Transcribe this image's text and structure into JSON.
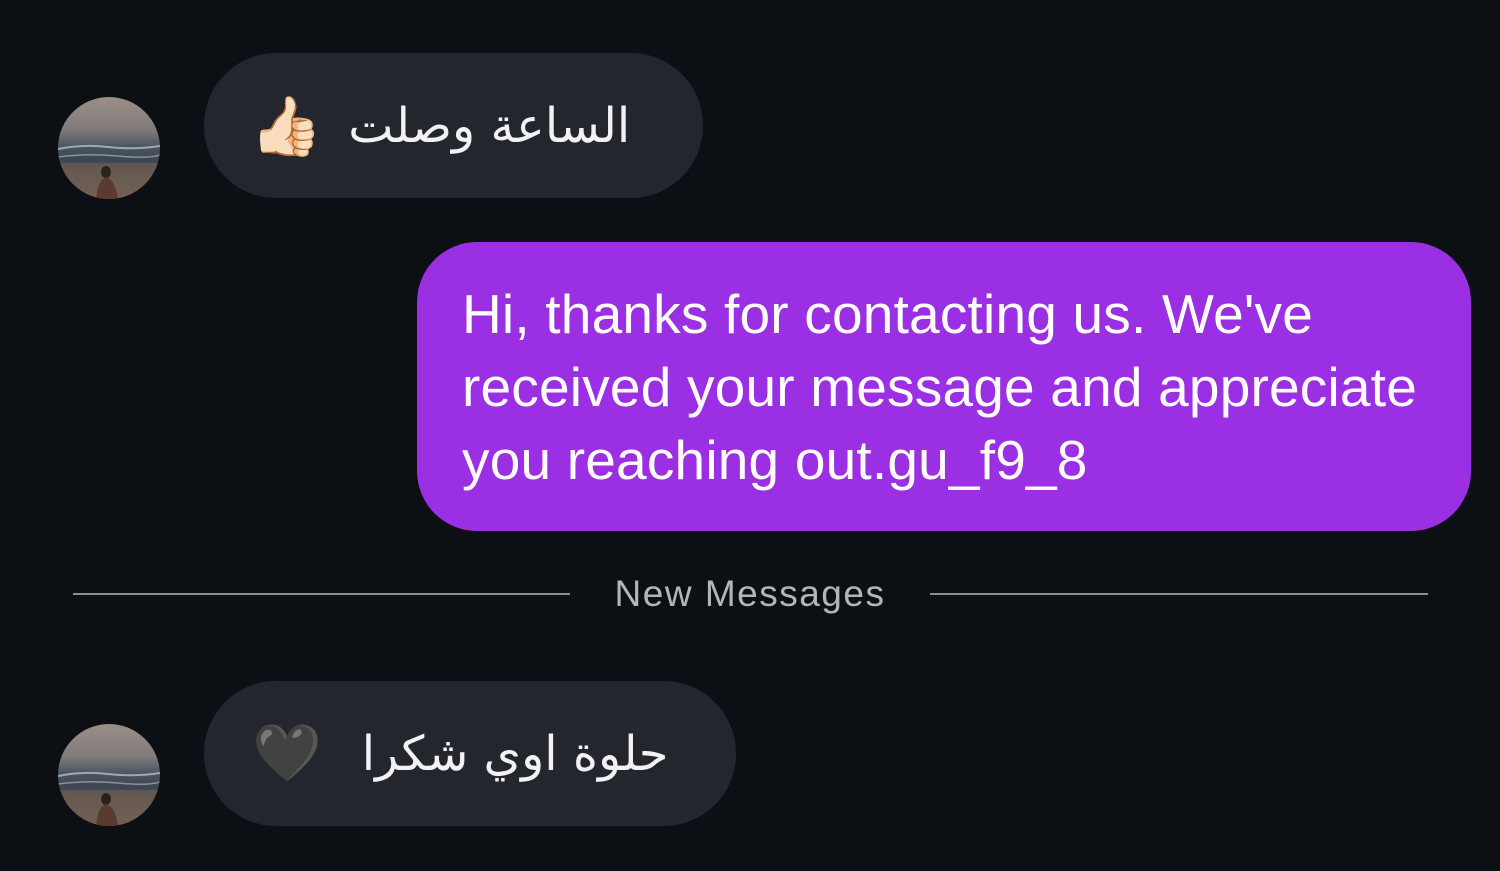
{
  "conversation": {
    "messages": [
      {
        "direction": "incoming",
        "text": "الساعة وصلت",
        "emoji": "👍🏻",
        "emoji_icon": "thumbs-up-icon"
      },
      {
        "direction": "outgoing",
        "text": "Hi, thanks for contacting us. We've received your message and appreciate you reaching out.gu_f9_8"
      },
      {
        "direction": "incoming",
        "text": "حلوة اوي شكرا",
        "emoji": "🖤",
        "emoji_icon": "black-heart-icon"
      }
    ],
    "divider": {
      "label": "New Messages"
    }
  },
  "colors": {
    "background": "#0c0f14",
    "incoming_bubble": "#24262d",
    "outgoing_bubble": "#9b2fe3",
    "divider": "#8a8d94"
  }
}
